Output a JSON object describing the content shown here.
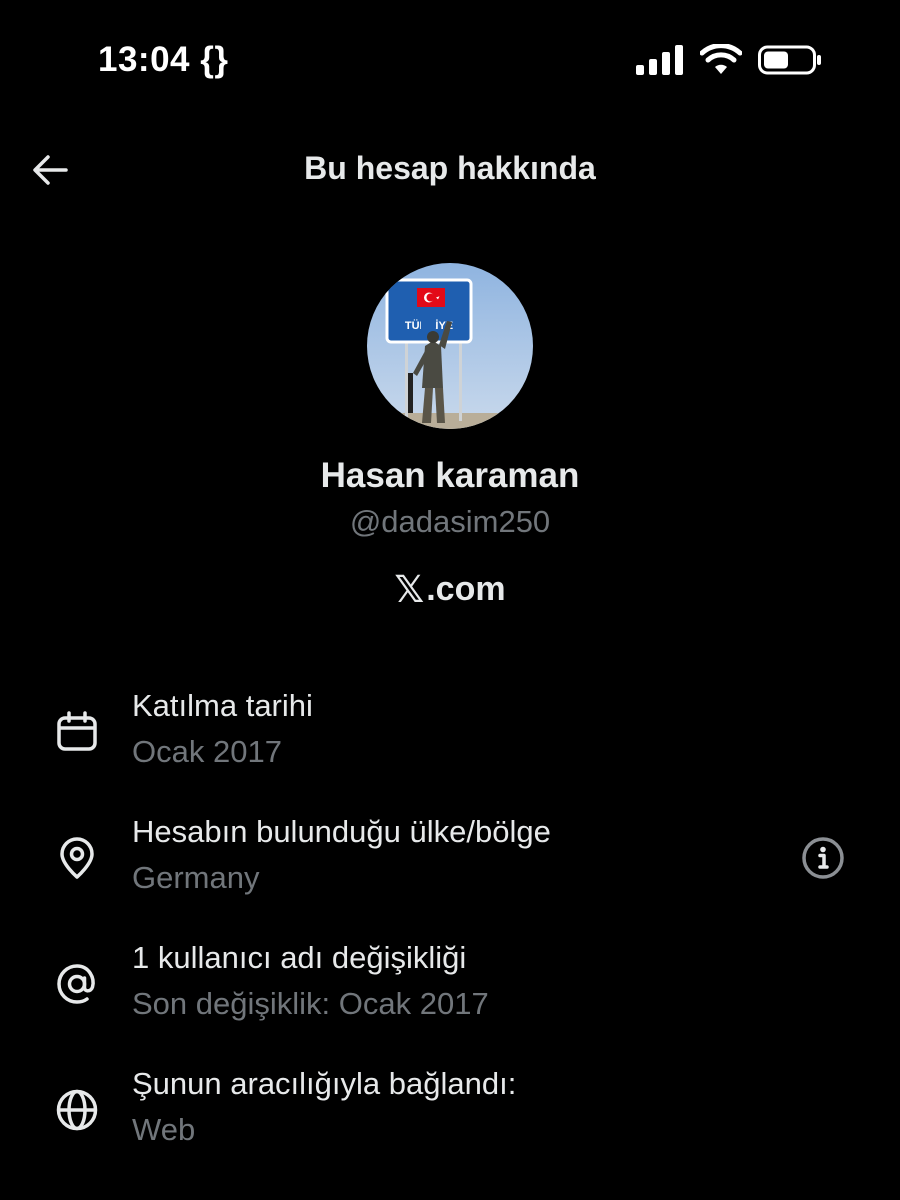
{
  "status_bar": {
    "time": "13:04 {}"
  },
  "header": {
    "title": "Bu hesap hakkında",
    "back_icon": "arrow-left-icon"
  },
  "profile": {
    "display_name": "Hasan karaman",
    "handle": "@dadasim250",
    "source_logo": "𝕏",
    "source_domain": ".com",
    "avatar_sign_text": "TÜRKİYE"
  },
  "info": {
    "joined": {
      "icon": "calendar-icon",
      "label": "Katılma tarihi",
      "value": "Ocak 2017"
    },
    "location": {
      "icon": "location-pin-icon",
      "label": "Hesabın bulunduğu ülke/bölge",
      "value": "Germany",
      "action_icon": "info-icon"
    },
    "username_changes": {
      "icon": "at-sign-icon",
      "label": "1 kullanıcı adı değişikliği",
      "value": "Son değişiklik: Ocak 2017"
    },
    "connected_via": {
      "icon": "globe-icon",
      "label": "Şunun aracılığıyla bağlandı:",
      "value": "Web"
    }
  },
  "colors": {
    "background": "#000000",
    "primary_text": "#e7e9ea",
    "secondary_text": "#71767b",
    "flag_red": "#e30a17",
    "sign_blue": "#1f5fb0"
  }
}
